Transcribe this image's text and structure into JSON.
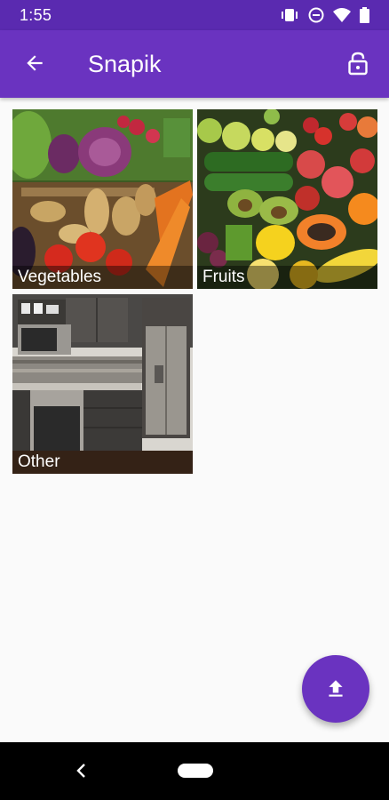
{
  "status_bar": {
    "time": "1:55",
    "icons": [
      "vibrate-icon",
      "do-not-disturb-icon",
      "wifi-icon",
      "battery-icon"
    ]
  },
  "app_bar": {
    "title": "Snapik",
    "back_icon": "arrow-back-icon",
    "lock_icon": "lock-open-icon"
  },
  "categories": [
    {
      "label": "Vegetables"
    },
    {
      "label": "Fruits"
    },
    {
      "label": "Other"
    }
  ],
  "fab": {
    "icon": "upload-icon"
  },
  "colors": {
    "primary": "#6a33c0",
    "primary_dark": "#5a2ab0",
    "background": "#fafafa"
  }
}
